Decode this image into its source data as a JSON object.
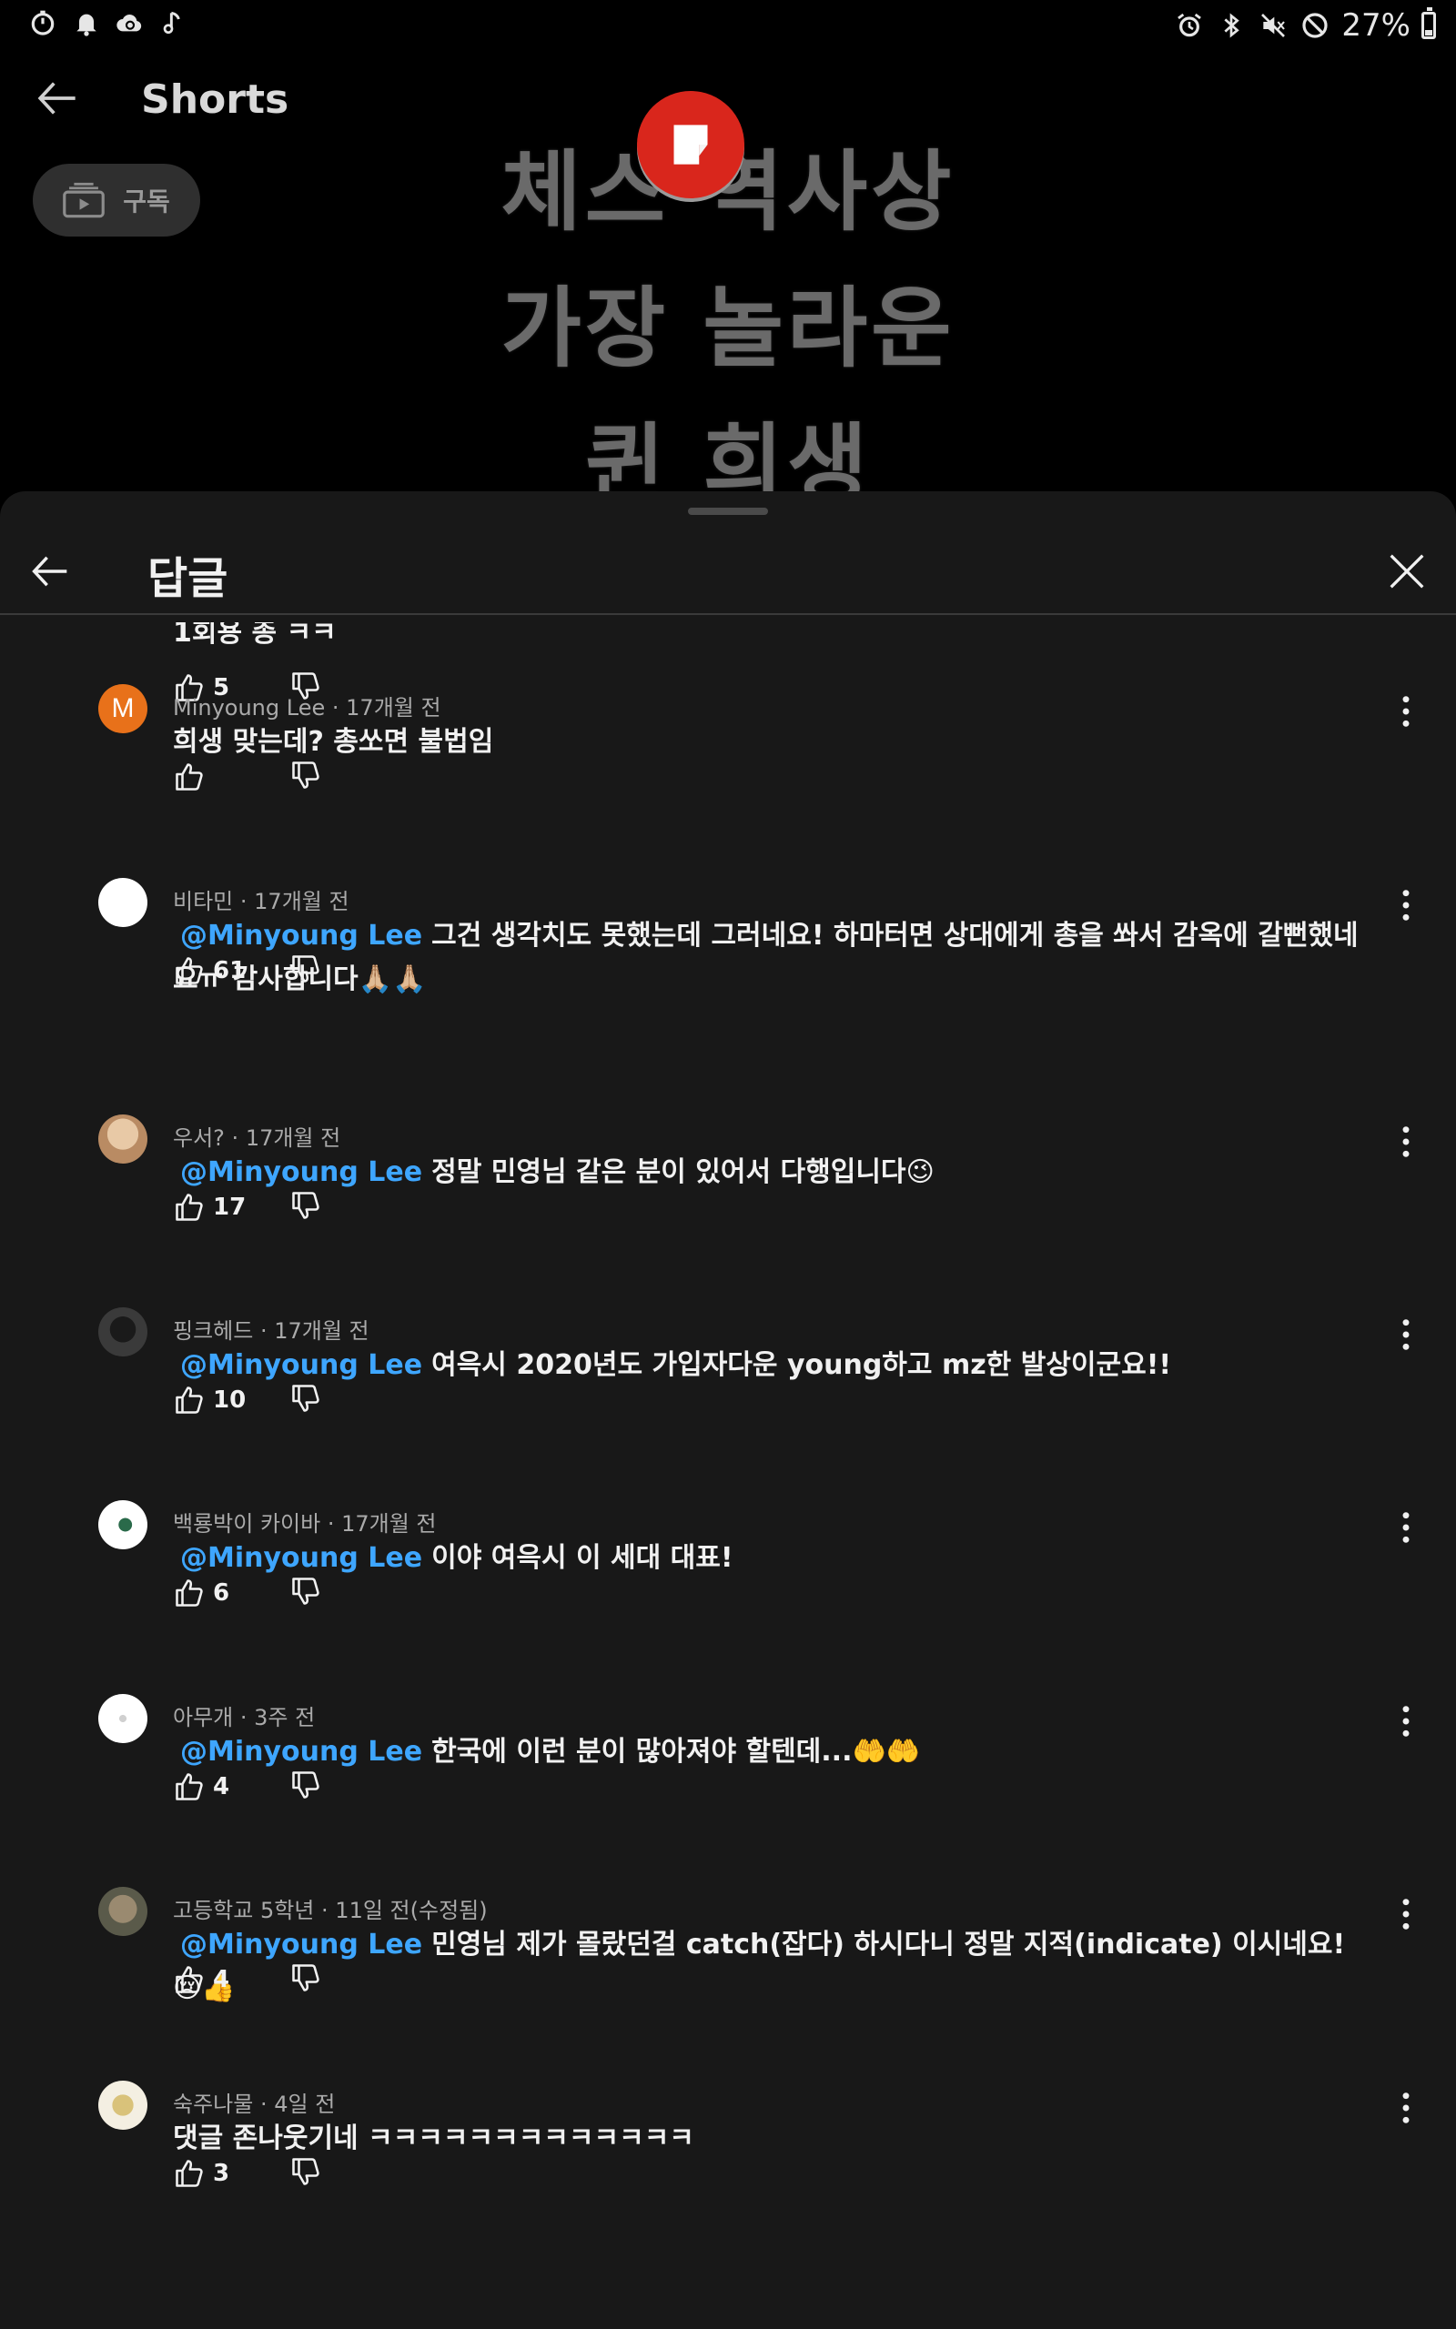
{
  "status_bar": {
    "battery_text": "27%",
    "battery_level": 0.27,
    "left_icons": [
      "timer-icon",
      "bell-icon",
      "cloud-sync-icon",
      "music-note-icon"
    ],
    "right_icons": [
      "alarm-icon",
      "bluetooth-icon",
      "mute-icon",
      "no-signal-icon"
    ]
  },
  "header": {
    "title": "Shorts",
    "subscribe_label": "구독"
  },
  "video": {
    "lines": [
      "체스 역사상",
      "가장 놀라운",
      "퀸 희생"
    ]
  },
  "sheet": {
    "title": "답글"
  },
  "partial_comment": {
    "text": "1회용 총 ㅋㅋ",
    "likes": "5"
  },
  "comments": [
    {
      "author": "Minyoung Lee",
      "time": "17개월 전",
      "mention": "",
      "text": "희생 맞는데? 총쏘면 불법임",
      "likes": "",
      "avatar_letter": "M"
    },
    {
      "author": "비타민",
      "time": "17개월 전",
      "mention": "@Minyoung Lee",
      "text": "그건 생각치도 못했는데 그러네요! 하마터면 상대에게 총을 쏴서 감옥에 갈뻔했네요ㅠ 감사합니다🙏🏼🙏🏼",
      "likes": "61",
      "avatar_letter": ""
    },
    {
      "author": "우서?",
      "time": "17개월 전",
      "mention": "@Minyoung Lee",
      "text": "정말 민영님 같은 분이 있어서 다행입니다😉",
      "likes": "17",
      "avatar_letter": ""
    },
    {
      "author": "핑크헤드",
      "time": "17개월 전",
      "mention": "@Minyoung Lee",
      "text": "여윽시 2020년도 가입자다운 young하고 mz한 발상이군요!!",
      "likes": "10",
      "avatar_letter": ""
    },
    {
      "author": "백룡박이 카이바",
      "time": "17개월 전",
      "mention": "@Minyoung Lee",
      "text": "이야 여윽시 이 세대 대표!",
      "likes": "6",
      "avatar_letter": ""
    },
    {
      "author": "아무개",
      "time": "3주 전",
      "mention": "@Minyoung Lee",
      "text": "한국에 이런 분이 많아져야 할텐데...🤲🤲",
      "likes": "4",
      "avatar_letter": ""
    },
    {
      "author": "고등학교 5학년",
      "time": "11일 전(수정됨)",
      "mention": "@Minyoung Lee",
      "text": "민영님 제가 몰랐던걸 catch(잡다) 하시다니 정말 지적(indicate) 이시네요! 😢👍",
      "likes": "4",
      "avatar_letter": ""
    },
    {
      "author": "숙주나물",
      "time": "4일 전",
      "mention": "",
      "text": "댓글 존나웃기네 ㅋㅋㅋㅋㅋㅋㅋㅋㅋㅋㅋㅋㅋ",
      "likes": "3",
      "avatar_letter": ""
    }
  ],
  "colors": {
    "sheet_bg": "#181818",
    "mention": "#3ea6ff",
    "meta_text": "#aaaaaa",
    "avatar_orange": "#e8711a"
  }
}
